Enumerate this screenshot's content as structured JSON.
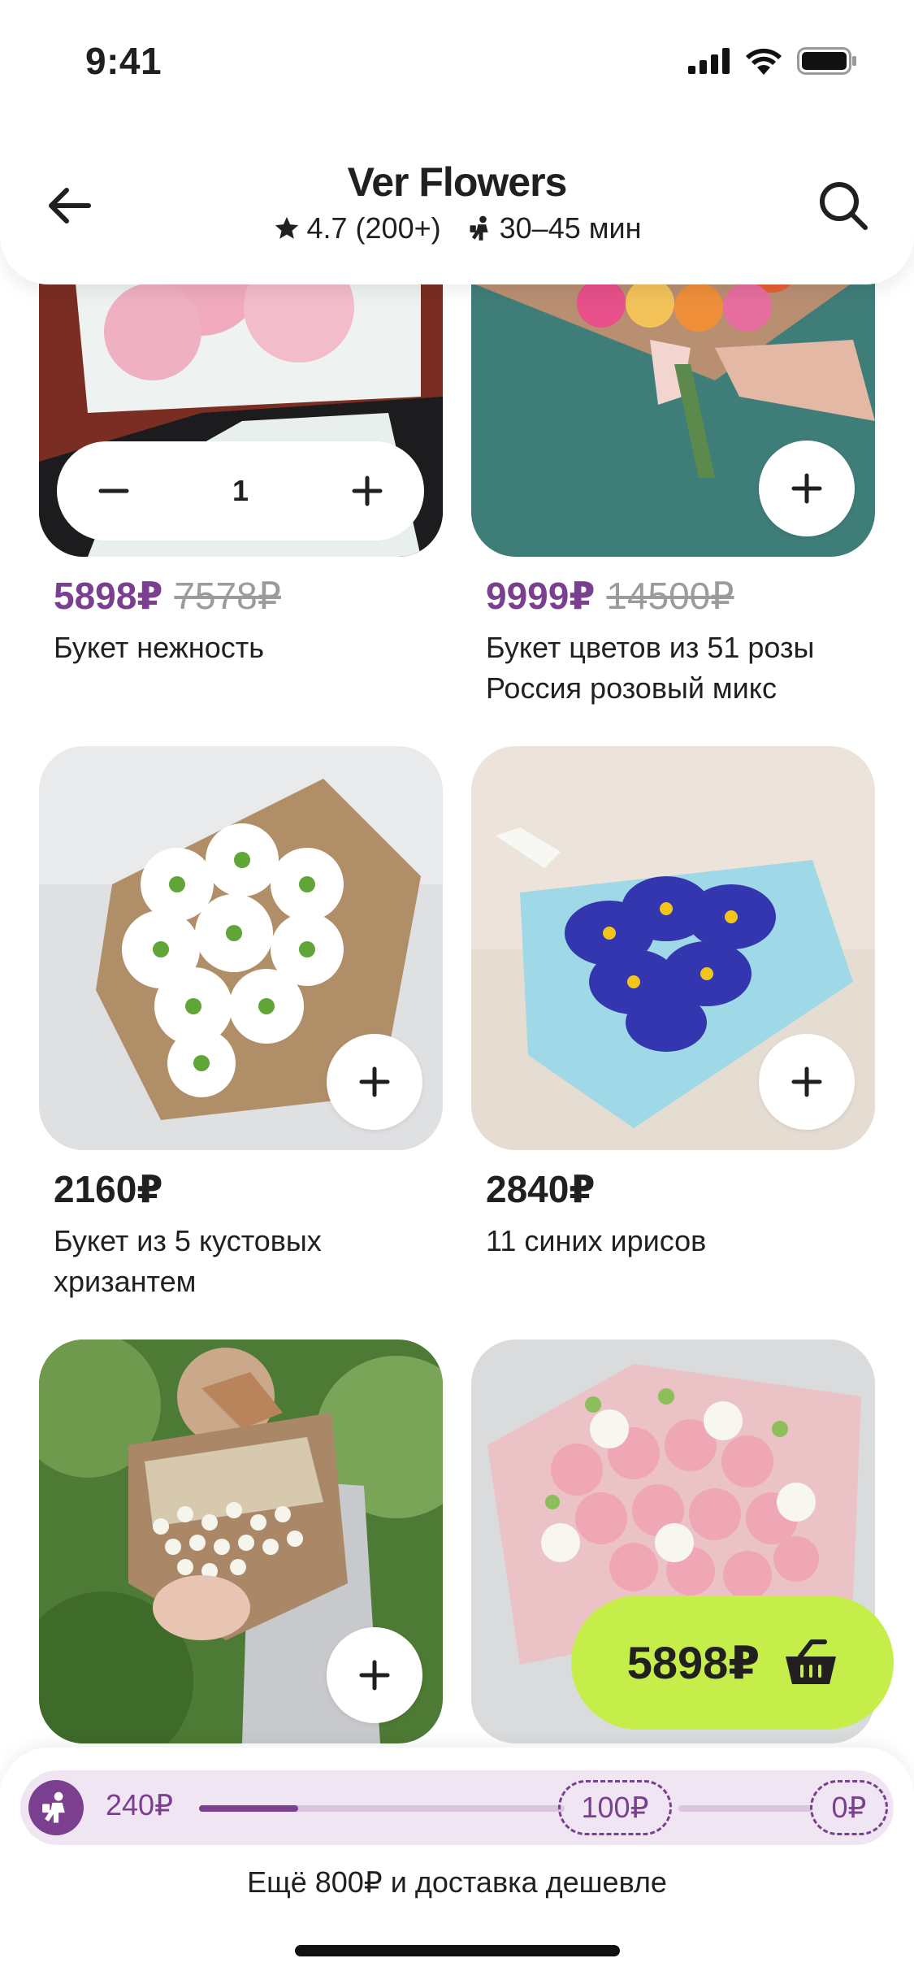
{
  "status": {
    "time": "9:41"
  },
  "header": {
    "title": "Ver Flowers",
    "rating": "4.7 (200+)",
    "delivery_time": "30–45 мин"
  },
  "products": [
    {
      "price": "5898₽",
      "old_price": "7578₽",
      "name": "Букет нежность",
      "quantity": "1",
      "in_cart": true
    },
    {
      "price": "9999₽",
      "old_price": "14500₽",
      "name": "Букет цветов из 51 розы Россия розовый микс",
      "in_cart": false
    },
    {
      "price": "2160₽",
      "old_price": "",
      "name": "Букет из 5 кустовых хризантем",
      "in_cart": false
    },
    {
      "price": "2840₽",
      "old_price": "",
      "name": "11 синих ирисов",
      "in_cart": false
    },
    {
      "price": "",
      "old_price": "",
      "name": "",
      "in_cart": false
    },
    {
      "price": "",
      "old_price": "",
      "name": "",
      "in_cart": false
    }
  ],
  "cart": {
    "total": "5898₽"
  },
  "delivery": {
    "current_cost": "240₽",
    "tier_1": "100₽",
    "tier_2": "0₽",
    "progress_to_next_tier": 0.27,
    "note": "Ещё 800₽ и доставка дешевле"
  },
  "colors": {
    "accent": "#7b3f8f",
    "cart": "#c6ee4a"
  }
}
